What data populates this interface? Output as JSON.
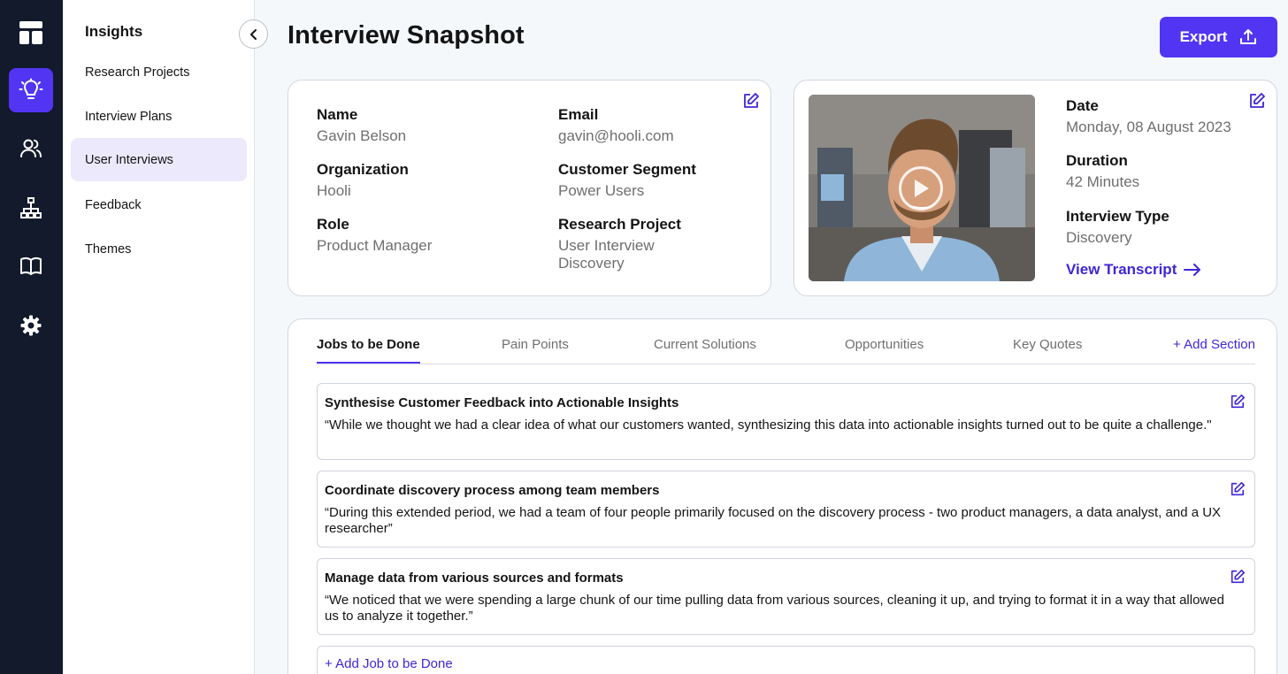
{
  "rail": {
    "items": [
      {
        "icon": "layout-icon",
        "active": false
      },
      {
        "icon": "lightbulb-icon",
        "active": true
      },
      {
        "icon": "users-icon",
        "active": false
      },
      {
        "icon": "sitemap-icon",
        "active": false
      },
      {
        "icon": "book-icon",
        "active": false
      },
      {
        "icon": "gear-icon",
        "active": false
      }
    ],
    "accent": "#5135f3",
    "background": "#121a2c"
  },
  "subnav": {
    "title": "Insights",
    "collapse_icon": "chevron-left-icon",
    "items": [
      {
        "label": "Research Projects",
        "active": false
      },
      {
        "label": "Interview Plans",
        "active": false
      },
      {
        "label": "User Interviews",
        "active": true
      },
      {
        "label": "Feedback",
        "active": false
      },
      {
        "label": "Themes",
        "active": false
      }
    ]
  },
  "header": {
    "title": "Interview Snapshot",
    "export_label": "Export",
    "export_icon": "upload-icon"
  },
  "profile": {
    "fields": [
      {
        "label": "Name",
        "value": "Gavin Belson"
      },
      {
        "label": "Email",
        "value": "gavin@hooli.com"
      },
      {
        "label": "Organization",
        "value": "Hooli"
      },
      {
        "label": "Customer Segment",
        "value": "Power Users"
      },
      {
        "label": "Role",
        "value": "Product Manager"
      },
      {
        "label": "Research Project",
        "value": "User Interview Discovery"
      }
    ]
  },
  "interview": {
    "fields": [
      {
        "label": "Date",
        "value": "Monday, 08 August 2023"
      },
      {
        "label": "Duration",
        "value": "42 Minutes"
      },
      {
        "label": "Interview Type",
        "value": "Discovery"
      }
    ],
    "transcript_link": "View Transcript",
    "play_icon": "play-icon"
  },
  "tabs": {
    "items": [
      "Jobs to be Done",
      "Pain Points",
      "Current Solutions",
      "Opportunities",
      "Key Quotes"
    ],
    "active": "Jobs to be Done",
    "add_label": "+ Add Section"
  },
  "jobs": [
    {
      "title": "Synthesise Customer Feedback into Actionable Insights",
      "quote": "“While we thought we had a clear idea of what our customers wanted, synthesizing this data into actionable insights turned out to be quite a challenge.\""
    },
    {
      "title": "Coordinate discovery process among team members",
      "quote": "“During this extended period, we had a team of four people primarily focused on the discovery process - two product managers, a data analyst, and a UX researcher”"
    },
    {
      "title": "Manage data from various sources and formats",
      "quote": "“We noticed that we were spending a large chunk of our time pulling data from various sources, cleaning it up, and trying to format it in a way that allowed us to analyze it together.”"
    }
  ],
  "add_job_label": "+ Add Job to be Done"
}
